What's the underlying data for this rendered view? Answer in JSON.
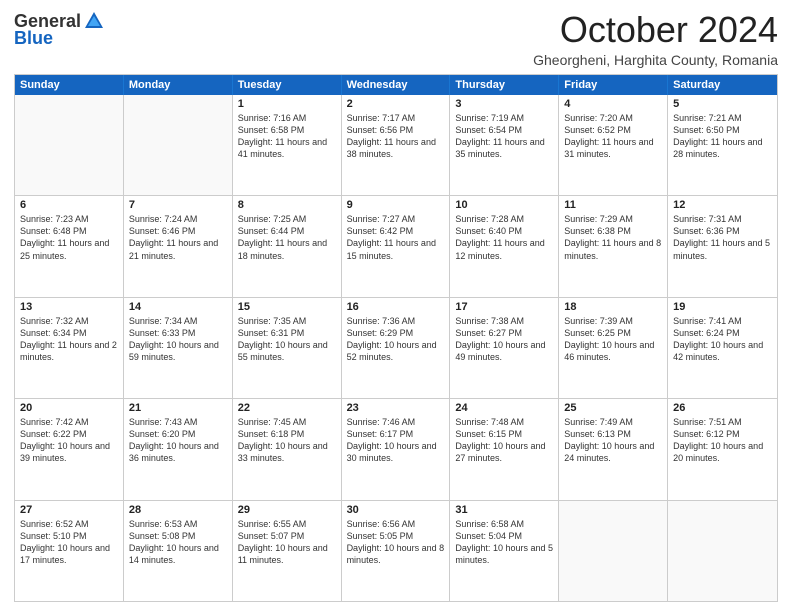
{
  "logo": {
    "general": "General",
    "blue": "Blue"
  },
  "title": "October 2024",
  "subtitle": "Gheorgheni, Harghita County, Romania",
  "header_days": [
    "Sunday",
    "Monday",
    "Tuesday",
    "Wednesday",
    "Thursday",
    "Friday",
    "Saturday"
  ],
  "weeks": [
    [
      {
        "day": "",
        "info": ""
      },
      {
        "day": "",
        "info": ""
      },
      {
        "day": "1",
        "info": "Sunrise: 7:16 AM\nSunset: 6:58 PM\nDaylight: 11 hours and 41 minutes."
      },
      {
        "day": "2",
        "info": "Sunrise: 7:17 AM\nSunset: 6:56 PM\nDaylight: 11 hours and 38 minutes."
      },
      {
        "day": "3",
        "info": "Sunrise: 7:19 AM\nSunset: 6:54 PM\nDaylight: 11 hours and 35 minutes."
      },
      {
        "day": "4",
        "info": "Sunrise: 7:20 AM\nSunset: 6:52 PM\nDaylight: 11 hours and 31 minutes."
      },
      {
        "day": "5",
        "info": "Sunrise: 7:21 AM\nSunset: 6:50 PM\nDaylight: 11 hours and 28 minutes."
      }
    ],
    [
      {
        "day": "6",
        "info": "Sunrise: 7:23 AM\nSunset: 6:48 PM\nDaylight: 11 hours and 25 minutes."
      },
      {
        "day": "7",
        "info": "Sunrise: 7:24 AM\nSunset: 6:46 PM\nDaylight: 11 hours and 21 minutes."
      },
      {
        "day": "8",
        "info": "Sunrise: 7:25 AM\nSunset: 6:44 PM\nDaylight: 11 hours and 18 minutes."
      },
      {
        "day": "9",
        "info": "Sunrise: 7:27 AM\nSunset: 6:42 PM\nDaylight: 11 hours and 15 minutes."
      },
      {
        "day": "10",
        "info": "Sunrise: 7:28 AM\nSunset: 6:40 PM\nDaylight: 11 hours and 12 minutes."
      },
      {
        "day": "11",
        "info": "Sunrise: 7:29 AM\nSunset: 6:38 PM\nDaylight: 11 hours and 8 minutes."
      },
      {
        "day": "12",
        "info": "Sunrise: 7:31 AM\nSunset: 6:36 PM\nDaylight: 11 hours and 5 minutes."
      }
    ],
    [
      {
        "day": "13",
        "info": "Sunrise: 7:32 AM\nSunset: 6:34 PM\nDaylight: 11 hours and 2 minutes."
      },
      {
        "day": "14",
        "info": "Sunrise: 7:34 AM\nSunset: 6:33 PM\nDaylight: 10 hours and 59 minutes."
      },
      {
        "day": "15",
        "info": "Sunrise: 7:35 AM\nSunset: 6:31 PM\nDaylight: 10 hours and 55 minutes."
      },
      {
        "day": "16",
        "info": "Sunrise: 7:36 AM\nSunset: 6:29 PM\nDaylight: 10 hours and 52 minutes."
      },
      {
        "day": "17",
        "info": "Sunrise: 7:38 AM\nSunset: 6:27 PM\nDaylight: 10 hours and 49 minutes."
      },
      {
        "day": "18",
        "info": "Sunrise: 7:39 AM\nSunset: 6:25 PM\nDaylight: 10 hours and 46 minutes."
      },
      {
        "day": "19",
        "info": "Sunrise: 7:41 AM\nSunset: 6:24 PM\nDaylight: 10 hours and 42 minutes."
      }
    ],
    [
      {
        "day": "20",
        "info": "Sunrise: 7:42 AM\nSunset: 6:22 PM\nDaylight: 10 hours and 39 minutes."
      },
      {
        "day": "21",
        "info": "Sunrise: 7:43 AM\nSunset: 6:20 PM\nDaylight: 10 hours and 36 minutes."
      },
      {
        "day": "22",
        "info": "Sunrise: 7:45 AM\nSunset: 6:18 PM\nDaylight: 10 hours and 33 minutes."
      },
      {
        "day": "23",
        "info": "Sunrise: 7:46 AM\nSunset: 6:17 PM\nDaylight: 10 hours and 30 minutes."
      },
      {
        "day": "24",
        "info": "Sunrise: 7:48 AM\nSunset: 6:15 PM\nDaylight: 10 hours and 27 minutes."
      },
      {
        "day": "25",
        "info": "Sunrise: 7:49 AM\nSunset: 6:13 PM\nDaylight: 10 hours and 24 minutes."
      },
      {
        "day": "26",
        "info": "Sunrise: 7:51 AM\nSunset: 6:12 PM\nDaylight: 10 hours and 20 minutes."
      }
    ],
    [
      {
        "day": "27",
        "info": "Sunrise: 6:52 AM\nSunset: 5:10 PM\nDaylight: 10 hours and 17 minutes."
      },
      {
        "day": "28",
        "info": "Sunrise: 6:53 AM\nSunset: 5:08 PM\nDaylight: 10 hours and 14 minutes."
      },
      {
        "day": "29",
        "info": "Sunrise: 6:55 AM\nSunset: 5:07 PM\nDaylight: 10 hours and 11 minutes."
      },
      {
        "day": "30",
        "info": "Sunrise: 6:56 AM\nSunset: 5:05 PM\nDaylight: 10 hours and 8 minutes."
      },
      {
        "day": "31",
        "info": "Sunrise: 6:58 AM\nSunset: 5:04 PM\nDaylight: 10 hours and 5 minutes."
      },
      {
        "day": "",
        "info": ""
      },
      {
        "day": "",
        "info": ""
      }
    ]
  ]
}
